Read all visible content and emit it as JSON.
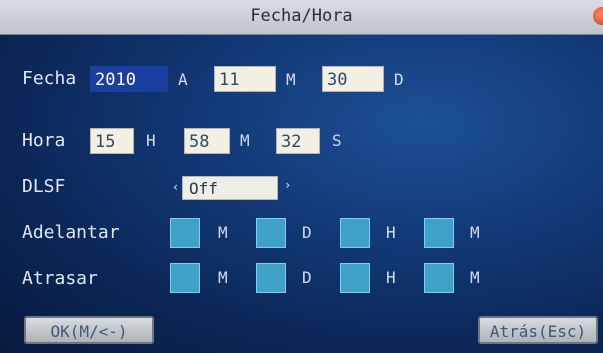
{
  "window": {
    "title": "Fecha/Hora"
  },
  "fecha": {
    "label": "Fecha",
    "year": "2010",
    "year_unit": "A",
    "month": "11",
    "month_unit": "M",
    "day": "30",
    "day_unit": "D"
  },
  "hora": {
    "label": "Hora",
    "hour": "15",
    "hour_unit": "H",
    "minute": "58",
    "minute_unit": "M",
    "second": "32",
    "second_unit": "S"
  },
  "dlsf": {
    "label": "DLSF",
    "value": "Off",
    "left_arrow": "‹",
    "right_arrow": "›"
  },
  "adelantar": {
    "label": "Adelantar",
    "units": [
      "M",
      "D",
      "H",
      "M"
    ]
  },
  "atrasar": {
    "label": "Atrasar",
    "units": [
      "M",
      "D",
      "H",
      "M"
    ]
  },
  "buttons": {
    "ok": "OK(M/<-)",
    "back": "Atrás(Esc)"
  },
  "colors": {
    "background": "#123a78",
    "field": "#f3f0e3",
    "selected": "#1a3f9e",
    "box": "#3fa0c8"
  }
}
